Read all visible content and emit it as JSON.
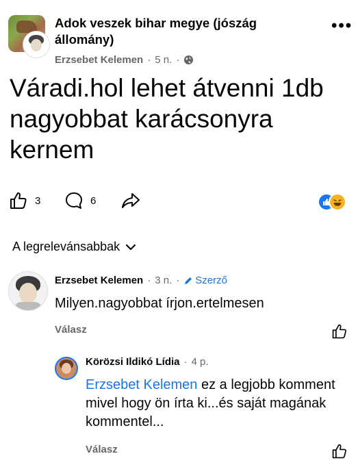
{
  "post": {
    "group_name": "Adok veszek bihar megye (jószág állomány)",
    "author": "Erzsebet Kelemen",
    "time": "5 n.",
    "dot": "·",
    "text": "Váradi.hol lehet átvenni 1db nagyobbat karácsonyra kernem",
    "more_label": "•••"
  },
  "actions": {
    "like_count": "3",
    "comment_count": "6",
    "reactions": [
      "like-reaction-icon",
      "haha-reaction-icon"
    ]
  },
  "sort_label": "A legrelevánsabbak",
  "comment": {
    "author": "Erzsebet Kelemen",
    "time": "3 n.",
    "badge": "Szerző",
    "text": "Milyen.nagyobbat írjon.ertelmesen",
    "reply_label": "Válasz"
  },
  "reply": {
    "author": "Körözsi Ildikó Lídia",
    "time": "4 p.",
    "mention": "Erzsebet Kelemen",
    "text": " ez a legjobb komment mivel hogy ön írta ki...és saját magának kommentel...",
    "reply_label": "Válasz"
  },
  "colors": {
    "text": "#050505",
    "secondary": "#65676b",
    "link": "#1b74e4",
    "like": "#1877f2",
    "haha": "#f7b125"
  }
}
